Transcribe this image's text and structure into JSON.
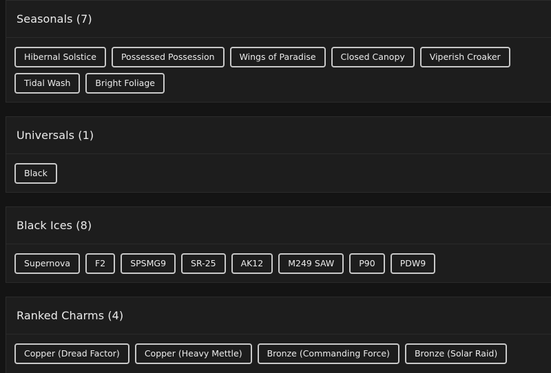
{
  "sections": [
    {
      "title": "Seasonals (7)",
      "tags": [
        "Hibernal Solstice",
        "Possessed Possession",
        "Wings of Paradise",
        "Closed Canopy",
        "Viperish Croaker",
        "Tidal Wash",
        "Bright Foliage"
      ]
    },
    {
      "title": "Universals (1)",
      "tags": [
        "Black"
      ]
    },
    {
      "title": "Black Ices (8)",
      "tags": [
        "Supernova",
        "F2",
        "SPSMG9",
        "SR-25",
        "AK12",
        "M249 SAW",
        "P90",
        "PDW9"
      ]
    },
    {
      "title": "Ranked Charms (4)",
      "tags": [
        "Copper (Dread Factor)",
        "Copper (Heavy Mettle)",
        "Bronze (Commanding Force)",
        "Bronze (Solar Raid)"
      ]
    }
  ]
}
